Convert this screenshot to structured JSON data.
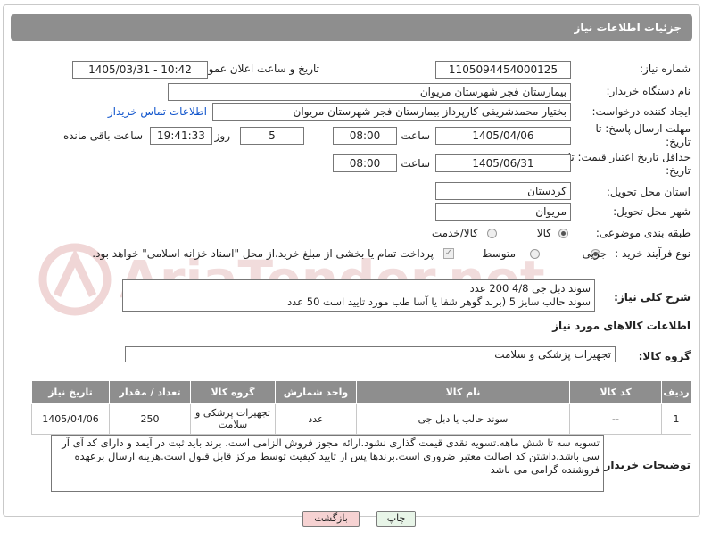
{
  "header": {
    "title": "جزئیات اطلاعات نیاز"
  },
  "labels": {
    "need_number": "شماره نیاز:",
    "announce_datetime": "تاریخ و ساعت اعلان عمومی:",
    "buyer_org": "نام دستگاه خریدار:",
    "creator": "ایجاد کننده درخواست:",
    "reply_deadline": "مهلت ارسال پاسخ: تا تاریخ:",
    "time": "ساعت",
    "day_and": "روز و",
    "remaining": "ساعت باقی مانده",
    "price_validity": "حداقل تاریخ اعتبار قیمت: تا تاریخ:",
    "delivery_province": "استان محل تحویل:",
    "delivery_city": "شهر محل تحویل:",
    "category": "طبقه بندی موضوعی:",
    "process_type": "نوع فرآیند خرید :",
    "general_desc": "شرح کلی نیاز:",
    "goods_info": "اطلاعات کالاهای مورد نیاز",
    "goods_group": "گروه کالا:",
    "buyer_notes": "توضیحات خریدار:"
  },
  "values": {
    "need_number": "1105094454000125",
    "announce_datetime": "1405/03/31 - 10:42",
    "buyer_org": "بیمارستان فجر شهرستان مریوان",
    "creator": "بختیار محمدشریفی کارپرداز بیمارستان فجر شهرستان مریوان",
    "contact_link": "اطلاعات تماس خریدار",
    "reply_date": "1405/04/06",
    "reply_time": "08:00",
    "days": "5",
    "remaining_time": "19:41:33",
    "validity_date": "1405/06/31",
    "validity_time": "08:00",
    "province": "کردستان",
    "city": "مریوان",
    "goods_group": "تجهیزات پزشکی و سلامت"
  },
  "category_options": {
    "goods": "کالا",
    "goods_service": "کالا/خدمت",
    "selected": "کالا"
  },
  "process_options": {
    "partial": "جزیی",
    "medium": "متوسط",
    "selected": "جزیی",
    "treasury_note": "پرداخت تمام یا بخشی از مبلغ خرید،از محل \"اسناد خزانه اسلامی\" خواهد بود."
  },
  "general_desc": {
    "line1": "سوند دبل جی 4/8    200 عدد",
    "line2": "سوند حالب سایز 5 (برند  گوهر شفا یا آسا طب مورد تایید است   50 عدد"
  },
  "table": {
    "headers": [
      "ردیف",
      "کد کالا",
      "نام کالا",
      "واحد شمارش",
      "گروه کالا",
      "تعداد / مقدار",
      "تاریخ نیاز"
    ],
    "rows": [
      [
        "1",
        "--",
        "سوند حالب یا دبل جی",
        "عدد",
        "تجهیزات پزشکی و سلامت",
        "250",
        "1405/04/06"
      ]
    ]
  },
  "buyer_notes": "تسویه سه تا شش ماهه.تسویه نقدی قیمت گذاری نشود.ارائه مجوز فروش الزامی است. برند باید ثبت در آیمد و دارای کد آی آر سی باشد.داشتن کد اصالت معتبر ضروری است.برندها پس از تایید کیفیت توسط مرکز قابل قبول است.هزینه ارسال برعهده فروشنده گرامی می باشد",
  "buttons": {
    "print": "چاپ",
    "back": "بازگشت"
  },
  "watermark": "AriaTender.net",
  "colors": {
    "header_bg": "#8e8e8e",
    "link": "#1155cc",
    "back_btn": "#f6d2d2",
    "print_btn": "#e8f5e8"
  }
}
